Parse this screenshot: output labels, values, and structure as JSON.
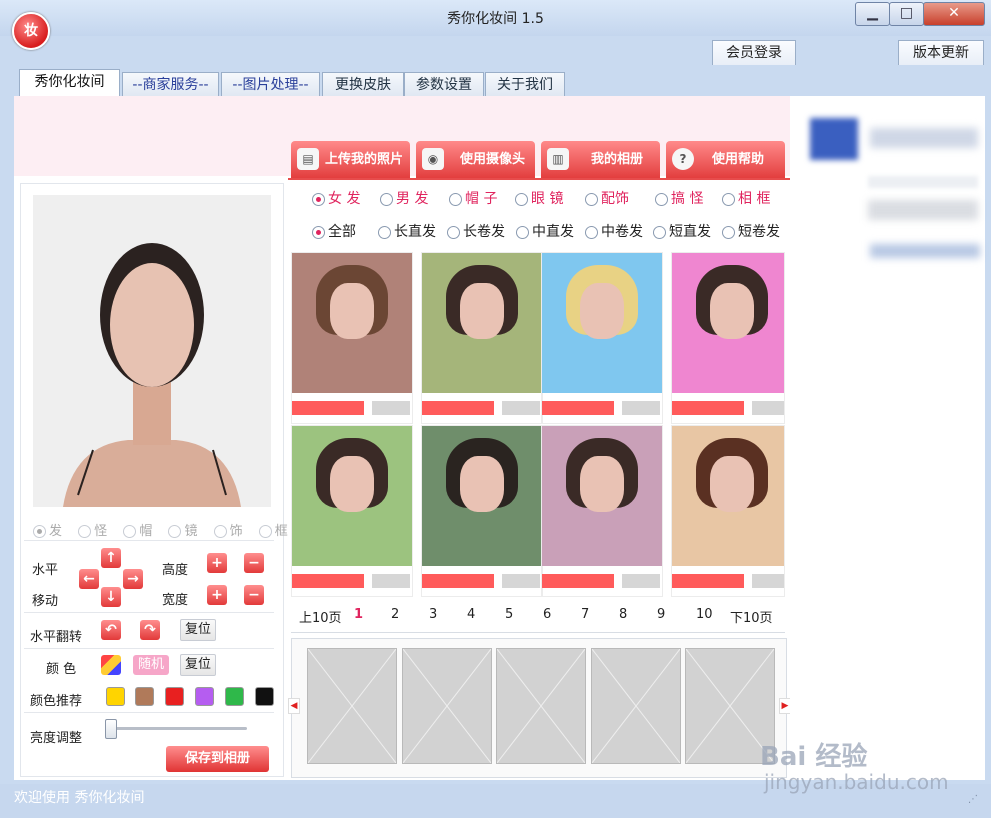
{
  "window": {
    "title": "秀你化妆间 1.5",
    "icon_char": "妆",
    "minimize": "▁",
    "maximize": "□",
    "close": "✕"
  },
  "top_buttons": {
    "login": "会员登录",
    "update": "版本更新"
  },
  "tabs": [
    {
      "label": "秀你化妆间",
      "active": true
    },
    {
      "label": "--商家服务--",
      "active": false
    },
    {
      "label": "--图片处理--",
      "active": false
    },
    {
      "label": "更换皮肤",
      "active": false
    },
    {
      "label": "参数设置",
      "active": false
    },
    {
      "label": "关于我们",
      "active": false
    }
  ],
  "action_tabs": [
    {
      "label": "上传我的照片",
      "icon": "upload-photo-icon",
      "glyph": "▤"
    },
    {
      "label": "使用摄像头",
      "icon": "camera-icon",
      "glyph": "◉"
    },
    {
      "label": "我的相册",
      "icon": "album-icon",
      "glyph": "▥"
    },
    {
      "label": "使用帮助",
      "icon": "help-icon",
      "glyph": "?"
    }
  ],
  "categories": [
    "女 发",
    "男 发",
    "帽 子",
    "眼 镜",
    "配饰",
    "搞 怪",
    "相 框"
  ],
  "selected_category": "女 发",
  "subcategories": [
    "全部",
    "长直发",
    "长卷发",
    "中直发",
    "中卷发",
    "短直发",
    "短卷发"
  ],
  "selected_subcategory": "全部",
  "photo_layers": [
    "发",
    "怪",
    "帽",
    "镜",
    "饰",
    "框"
  ],
  "controls": {
    "horizontal": "水平",
    "move": "移动",
    "height": "高度",
    "width": "宽度",
    "flip": "水平翻转",
    "reset": "复位",
    "color": "颜 色",
    "random": "随机",
    "color_recommend": "颜色推荐",
    "brightness": "亮度调整",
    "save": "保存到相册",
    "brightness_level": 0.0
  },
  "color_swatches": [
    "#ffd400",
    "#b07a5a",
    "#e82020",
    "#b55df0",
    "#2fb84a",
    "#111111"
  ],
  "pagination": {
    "prev": "上10页",
    "next": "下10页",
    "pages": [
      "1",
      "2",
      "3",
      "4",
      "5",
      "6",
      "7",
      "8",
      "9",
      "10"
    ],
    "current": "1"
  },
  "status": {
    "text": "欢迎使用  秀你化妆间"
  },
  "watermark": {
    "brand": "Bai 经验",
    "url": "jingyan.baidu.com"
  },
  "accent_color": "#e23c3c"
}
